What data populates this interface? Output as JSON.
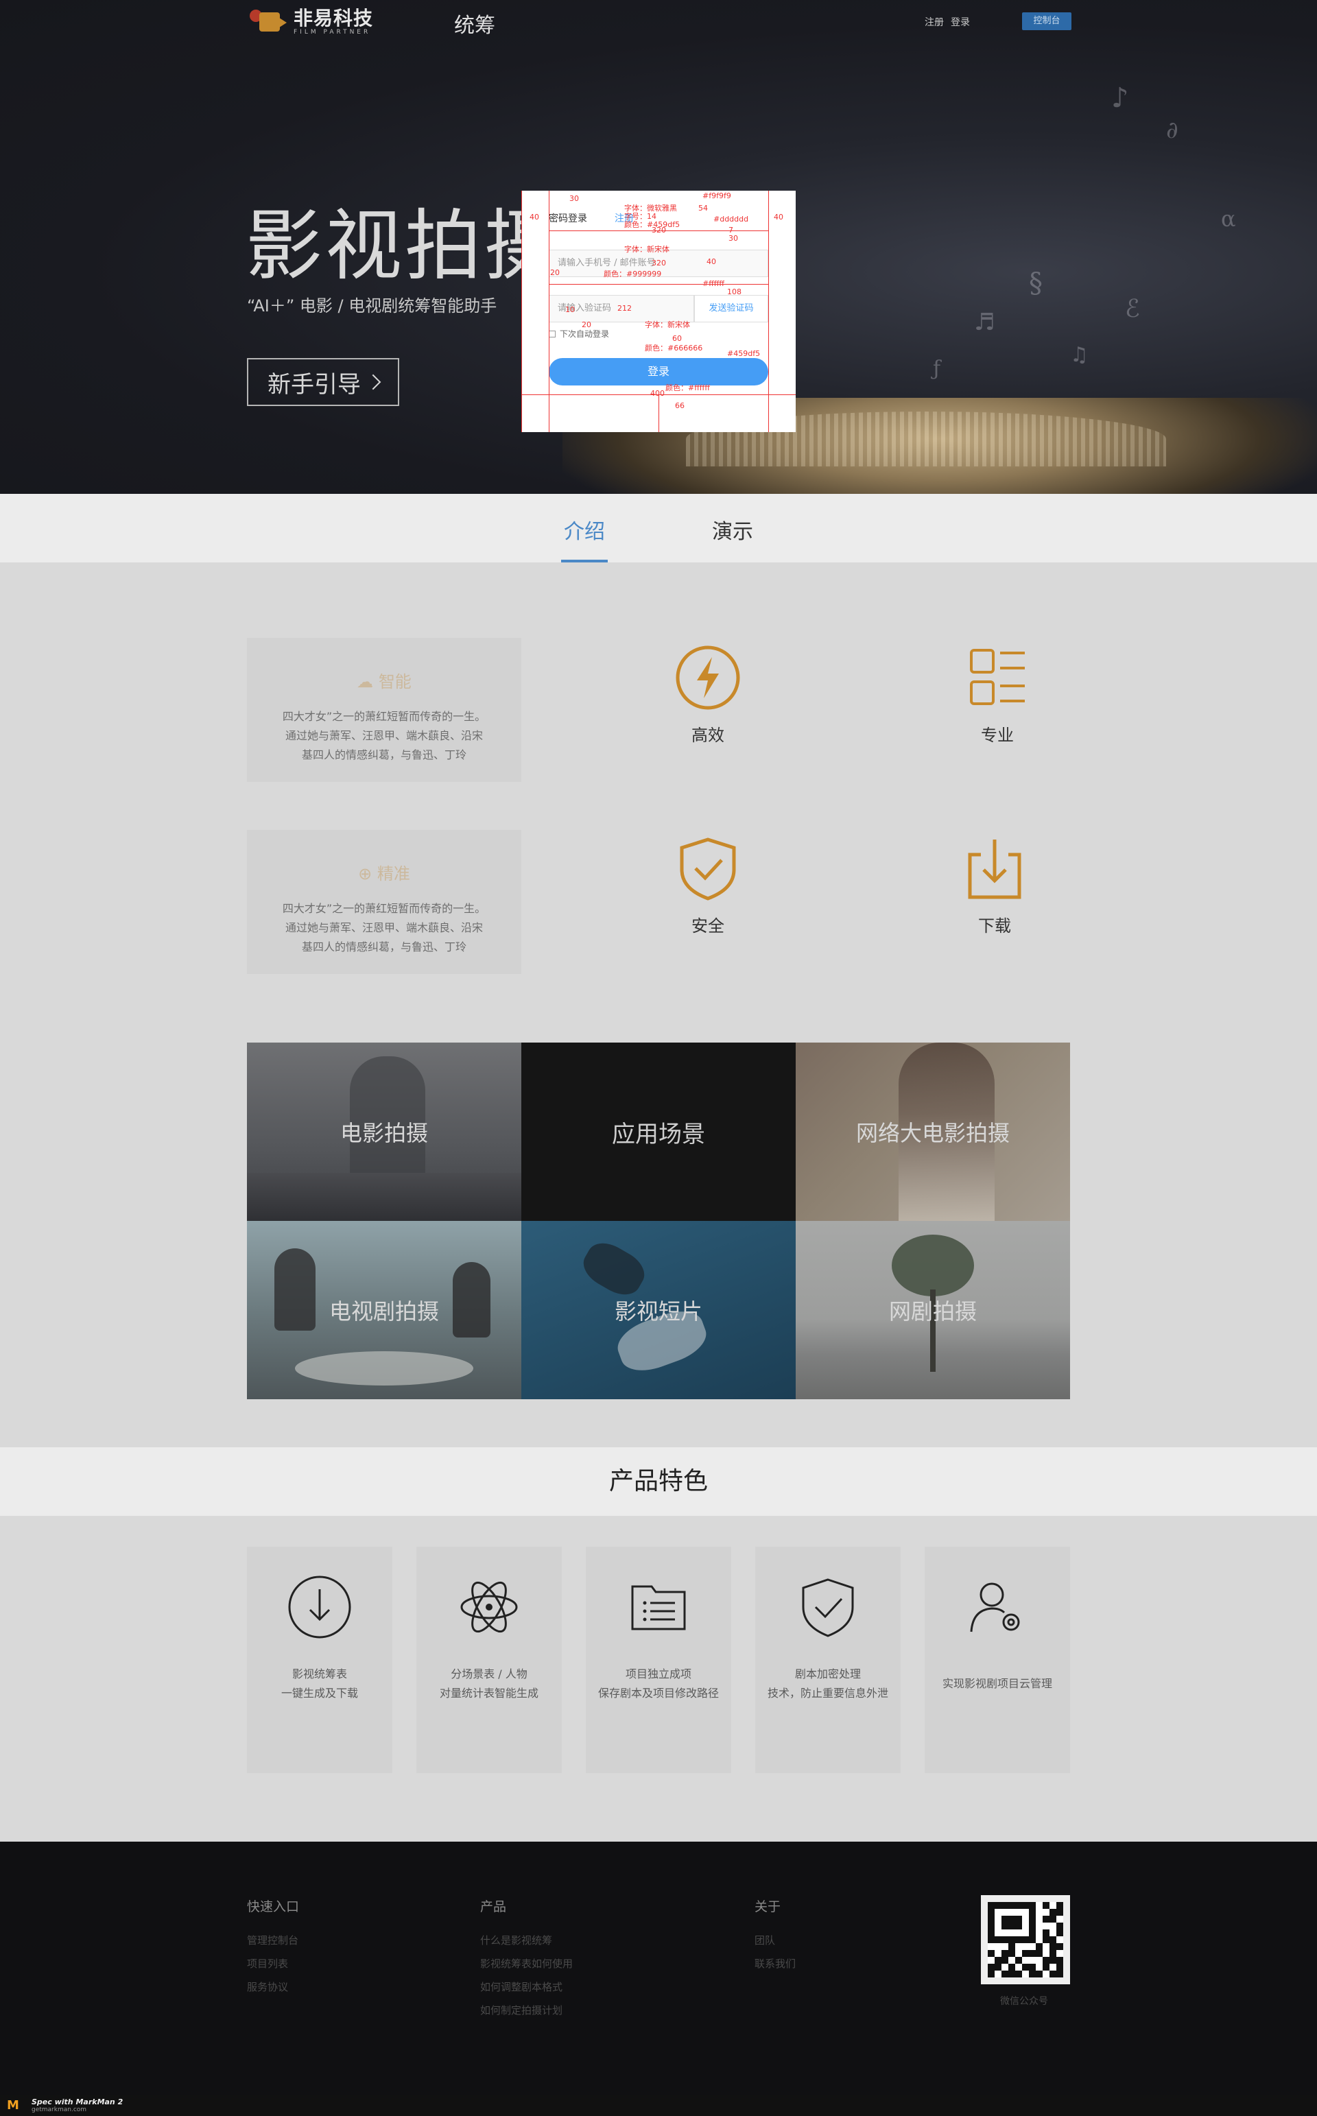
{
  "header": {
    "logo_cn": "非易科技",
    "logo_en": "FILM PARTNER",
    "nav_title": "统筹",
    "register": "注册",
    "login": "登录",
    "console": "控制台"
  },
  "hero": {
    "title": "影视拍摄 器",
    "subtitle": "“AI＋” 电影 / 电视剧统筹智能助手",
    "guide_button": "新手引导"
  },
  "login_spec": {
    "tab_active": "密码登录",
    "tab_link": "注册",
    "field_user_placeholder": "请输入手机号 / 邮件账号",
    "field_code_placeholder": "请输入验证码",
    "code_button": "发送验证码",
    "remember": "下次自动登录",
    "submit": "登录",
    "annotations": {
      "a1": "字体：微软雅黑",
      "a2": "字号：14",
      "a3": "颜色：#459df5",
      "a4": "#f9f9f9",
      "a5": "#dddddd",
      "a6": "字体：新宋体",
      "a7": "颜色：#999999",
      "a8": "#ffffff",
      "a9": "字体：新宋体",
      "a10": "颜色：#666666",
      "a11": "#459df5",
      "a12": "颜色：#ffffff",
      "n30": "30",
      "n54": "54",
      "n40a": "40",
      "n40b": "40",
      "n320a": "320",
      "n320b": "320",
      "n20a": "20",
      "n40c": "40",
      "n108": "108",
      "n212": "212",
      "n20b": "20",
      "n10": "10",
      "n60": "60",
      "n400": "400",
      "n66": "66",
      "n7": "7",
      "n30b": "30"
    }
  },
  "tabs": [
    "介绍",
    "演示"
  ],
  "features": {
    "card1_title": "智能",
    "card1_desc": [
      "四大才女”之一的萧红短暂而传奇的一生。",
      "通过她与萧军、汪恩甲、端木蕻良、沿宋",
      "基四人的情感纠葛，与鲁迅、丁玲"
    ],
    "card2_title": "精准",
    "card2_desc": [
      "四大才女”之一的萧红短暂而传奇的一生。",
      "通过她与萧军、汪恩甲、端木蕻良、沿宋",
      "基四人的情感纠葛，与鲁迅、丁玲"
    ],
    "items": [
      "高效",
      "专业",
      "安全",
      "下载"
    ],
    "accent": "#c8892a"
  },
  "scenes": {
    "tiles": [
      "电影拍摄",
      "应用场景",
      "网络大电影拍摄",
      "电视剧拍摄",
      "影视短片",
      "网剧拍摄"
    ]
  },
  "product_features": {
    "title": "产品特色",
    "cards": [
      [
        "影视统筹表",
        "一键生成及下载"
      ],
      [
        "分场景表 / 人物",
        "对量统计表智能生成"
      ],
      [
        "项目独立成项",
        "保存剧本及项目修改路径"
      ],
      [
        "剧本加密处理",
        "技术，防止重要信息外泄"
      ],
      [
        "实现影视剧项目云管理"
      ]
    ]
  },
  "footer": {
    "col1_title": "快速入口",
    "col1_items": [
      "管理控制台",
      "项目列表",
      "服务协议"
    ],
    "col2_title": "产品",
    "col2_items": [
      "什么是影视统筹",
      "影视统筹表如何使用",
      "如何调整剧本格式",
      "如何制定拍摄计划"
    ],
    "col3_title": "关于",
    "col3_items": [
      "团队",
      "联系我们"
    ],
    "qr_caption": "微信公众号"
  },
  "markman": {
    "brand": "Spec with MarkMan 2",
    "url": "getmarkman.com"
  }
}
